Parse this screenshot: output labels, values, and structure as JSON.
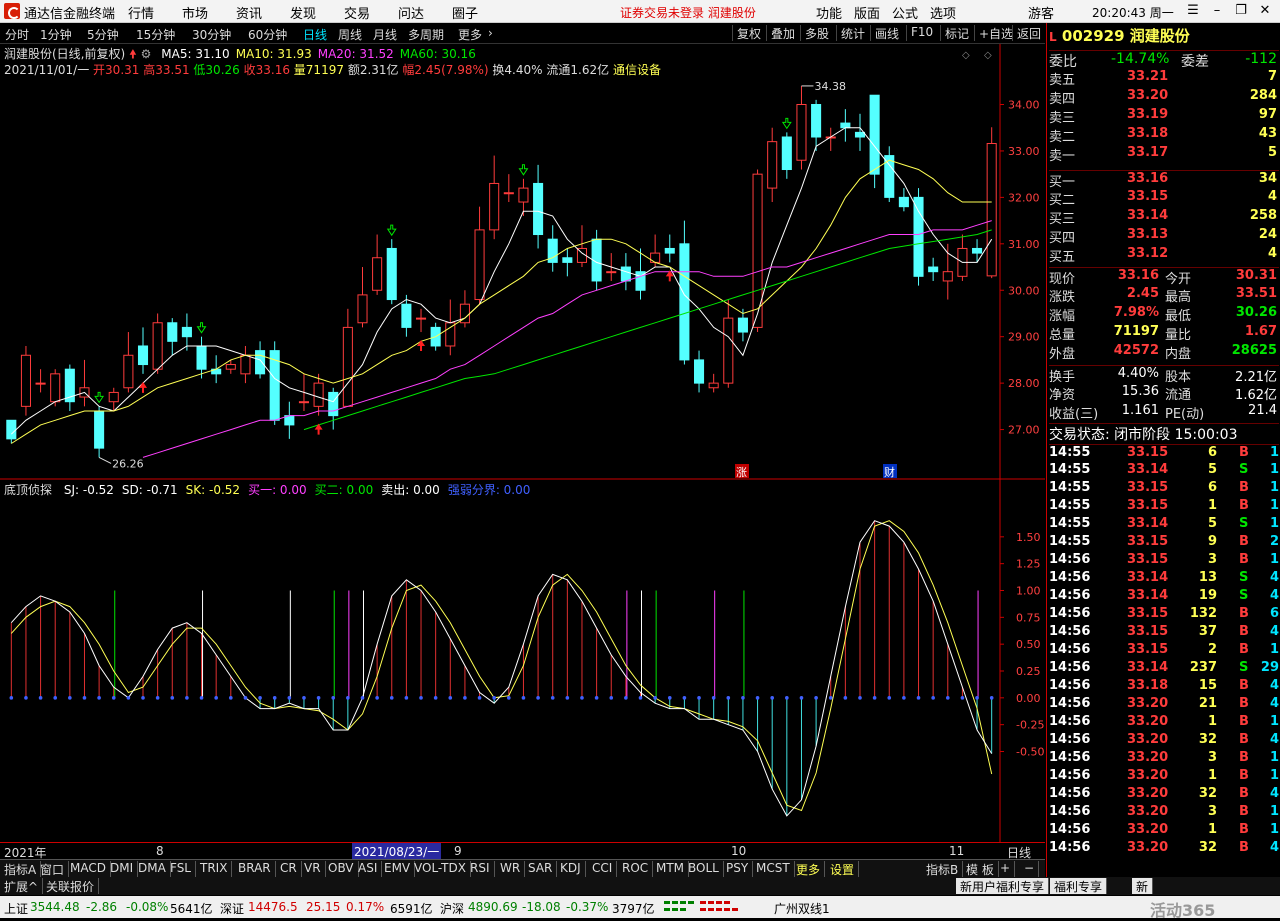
{
  "title_bar": {
    "app_name": "通达信金融终端",
    "menus": [
      "行情",
      "市场",
      "资讯",
      "发现",
      "交易",
      "问达",
      "圈子"
    ],
    "warning": "证券交易未登录  润建股份",
    "right_menus": [
      "功能",
      "版面",
      "公式",
      "选项"
    ],
    "guest": "游客",
    "clock": "20:20:43 周一"
  },
  "period_bar": {
    "items": [
      "分时",
      "1分钟",
      "5分钟",
      "15分钟",
      "30分钟",
      "60分钟",
      "日线",
      "周线",
      "月线",
      "多周期",
      "更多"
    ],
    "active": "日线",
    "tools": [
      "复权",
      "叠加",
      "多股",
      "统计",
      "画线",
      "F10",
      "标记",
      "+自选",
      "返回"
    ]
  },
  "main_chart": {
    "title": "润建股份(日线,前复权)",
    "ma_labels": [
      {
        "text": "MA5: 31.10",
        "color": "#ffffff"
      },
      {
        "text": "MA10: 31.93",
        "color": "#ffff54"
      },
      {
        "text": "MA20: 31.52",
        "color": "#ff40ff"
      },
      {
        "text": "MA60: 30.16",
        "color": "#00e600"
      }
    ],
    "info": {
      "date": "2021/11/01/一",
      "open": "开30.31",
      "high": "高33.51",
      "low": "低30.26",
      "close": "收33.16",
      "volume": "量71197",
      "amount": "额2.31亿",
      "change": "幅2.45(7.98%)",
      "turnover": "换4.40%",
      "float": "流通1.62亿",
      "industry": "通信设备"
    },
    "price_axis": [
      "34.00",
      "33.00",
      "32.00",
      "31.00",
      "30.00",
      "29.00",
      "28.00",
      "27.00"
    ],
    "high_mark": "34.38",
    "low_mark": "26.26",
    "event_zhang": "涨",
    "event_cai": "财"
  },
  "indicator": {
    "name": "底顶侦探",
    "labels": [
      {
        "text": "SJ: -0.52",
        "color": "#ffffff"
      },
      {
        "text": "SD: -0.71",
        "color": "#ffffff"
      },
      {
        "text": "SK: -0.52",
        "color": "#ffff54"
      },
      {
        "text": "买一: 0.00",
        "color": "#ff40ff"
      },
      {
        "text": "买二: 0.00",
        "color": "#00e600"
      },
      {
        "text": "卖出: 0.00",
        "color": "#ffffff"
      },
      {
        "text": "强弱分界: 0.00",
        "color": "#4060ff"
      }
    ],
    "axis": [
      "1.50",
      "1.25",
      "1.00",
      "0.75",
      "0.50",
      "0.25",
      "0.00",
      "-0.25",
      "-0.50"
    ]
  },
  "time_axis": {
    "labels": [
      "2021年",
      "8",
      "9",
      "10",
      "11"
    ],
    "cursor_date": "2021/08/23/一",
    "mode": "日线"
  },
  "quote_panel": {
    "code": "002929",
    "name": "润建股份",
    "weibi_label": "委比",
    "weibi": "-14.74%",
    "weicha_label": "委差",
    "weicha": "-112",
    "asks": [
      {
        "label": "卖五",
        "price": "33.21",
        "vol": "7"
      },
      {
        "label": "卖四",
        "price": "33.20",
        "vol": "284"
      },
      {
        "label": "卖三",
        "price": "33.19",
        "vol": "97"
      },
      {
        "label": "卖二",
        "price": "33.18",
        "vol": "43"
      },
      {
        "label": "卖一",
        "price": "33.17",
        "vol": "5"
      }
    ],
    "bids": [
      {
        "label": "买一",
        "price": "33.16",
        "vol": "34"
      },
      {
        "label": "买二",
        "price": "33.15",
        "vol": "4"
      },
      {
        "label": "买三",
        "price": "33.14",
        "vol": "258"
      },
      {
        "label": "买四",
        "price": "33.13",
        "vol": "24"
      },
      {
        "label": "买五",
        "price": "33.12",
        "vol": "4"
      }
    ],
    "stats": [
      {
        "l1": "现价",
        "v1": "33.16",
        "c1": "red",
        "l2": "今开",
        "v2": "30.31",
        "c2": "red"
      },
      {
        "l1": "涨跌",
        "v1": "2.45",
        "c1": "red",
        "l2": "最高",
        "v2": "33.51",
        "c2": "red"
      },
      {
        "l1": "涨幅",
        "v1": "7.98%",
        "c1": "red",
        "l2": "最低",
        "v2": "30.26",
        "c2": "green"
      },
      {
        "l1": "总量",
        "v1": "71197",
        "c1": "yellow",
        "l2": "量比",
        "v2": "1.67",
        "c2": "red"
      },
      {
        "l1": "外盘",
        "v1": "42572",
        "c1": "red",
        "l2": "内盘",
        "v2": "28625",
        "c2": "green"
      }
    ],
    "stats2": [
      {
        "l1": "换手",
        "v1": "4.40%",
        "l2": "股本",
        "v2": "2.21亿"
      },
      {
        "l1": "净资",
        "v1": "15.36",
        "l2": "流通",
        "v2": "1.62亿"
      },
      {
        "l1": "收益(三)",
        "v1": "1.161",
        "l2": "PE(动)",
        "v2": "21.4"
      }
    ],
    "trade_status": "交易状态: 闭市阶段 15:00:03",
    "ticks": [
      {
        "t": "14:55",
        "p": "33.15",
        "v": "6",
        "d": "B",
        "n": "1"
      },
      {
        "t": "14:55",
        "p": "33.14",
        "v": "5",
        "d": "S",
        "n": "1"
      },
      {
        "t": "14:55",
        "p": "33.15",
        "v": "6",
        "d": "B",
        "n": "1"
      },
      {
        "t": "14:55",
        "p": "33.15",
        "v": "1",
        "d": "B",
        "n": "1"
      },
      {
        "t": "14:55",
        "p": "33.14",
        "v": "5",
        "d": "S",
        "n": "1"
      },
      {
        "t": "14:55",
        "p": "33.15",
        "v": "9",
        "d": "B",
        "n": "2"
      },
      {
        "t": "14:56",
        "p": "33.15",
        "v": "3",
        "d": "B",
        "n": "1"
      },
      {
        "t": "14:56",
        "p": "33.14",
        "v": "13",
        "d": "S",
        "n": "4"
      },
      {
        "t": "14:56",
        "p": "33.14",
        "v": "19",
        "d": "S",
        "n": "4"
      },
      {
        "t": "14:56",
        "p": "33.15",
        "v": "132",
        "d": "B",
        "n": "6"
      },
      {
        "t": "14:56",
        "p": "33.15",
        "v": "37",
        "d": "B",
        "n": "4"
      },
      {
        "t": "14:56",
        "p": "33.15",
        "v": "2",
        "d": "B",
        "n": "1"
      },
      {
        "t": "14:56",
        "p": "33.14",
        "v": "237",
        "d": "S",
        "n": "29"
      },
      {
        "t": "14:56",
        "p": "33.18",
        "v": "15",
        "d": "B",
        "n": "4"
      },
      {
        "t": "14:56",
        "p": "33.20",
        "v": "21",
        "d": "B",
        "n": "4"
      },
      {
        "t": "14:56",
        "p": "33.20",
        "v": "1",
        "d": "B",
        "n": "1"
      },
      {
        "t": "14:56",
        "p": "33.20",
        "v": "32",
        "d": "B",
        "n": "4"
      },
      {
        "t": "14:56",
        "p": "33.20",
        "v": "3",
        "d": "B",
        "n": "1"
      },
      {
        "t": "14:56",
        "p": "33.20",
        "v": "1",
        "d": "B",
        "n": "1"
      },
      {
        "t": "14:56",
        "p": "33.20",
        "v": "32",
        "d": "B",
        "n": "4"
      },
      {
        "t": "14:56",
        "p": "33.20",
        "v": "3",
        "d": "B",
        "n": "1"
      },
      {
        "t": "14:56",
        "p": "33.20",
        "v": "1",
        "d": "B",
        "n": "1"
      },
      {
        "t": "14:56",
        "p": "33.20",
        "v": "32",
        "d": "B",
        "n": "4"
      }
    ]
  },
  "tabs": [
    "指标A",
    "窗口",
    "MACD",
    "DMI",
    "DMA",
    "FSL",
    "TRIX",
    "BRAR",
    "CR",
    "VR",
    "OBV",
    "ASI",
    "EMV",
    "VOL-TDX",
    "RSI",
    "WR",
    "SAR",
    "KDJ",
    "CCI",
    "ROC",
    "MTM",
    "BOLL",
    "PSY",
    "MCST",
    "更多",
    "设置"
  ],
  "tabs_right": [
    "指标B",
    "模 板",
    "+",
    "−"
  ],
  "tabs2": [
    "扩展^",
    "关联报价"
  ],
  "tabs2_right": [
    "新用户福利专享",
    "福利专享",
    "新"
  ],
  "status_bar": {
    "sh_label": "上证",
    "sh_val": "3544.48",
    "sh_chg": "-2.86",
    "sh_pct": "-0.08%",
    "sh_amt": "5641亿",
    "sz_label": "深证",
    "sz_val": "14476.5",
    "sz_chg": "25.15",
    "sz_pct": "0.17%",
    "sz_amt": "6591亿",
    "hs_label": "沪深",
    "hs_val": "4890.69",
    "hs_chg": "-18.08",
    "hs_pct": "-0.37%",
    "hs_amt": "3797亿",
    "server": "广州双线1",
    "watermark": "活动365"
  },
  "chart_data": {
    "type": "candlestick",
    "title": "润建股份(日线,前复权)",
    "y_range": [
      26.0,
      34.7
    ],
    "candles": [
      [
        27.2,
        26.8,
        27.0,
        26.7
      ],
      [
        27.5,
        28.6,
        28.8,
        27.3
      ],
      [
        28.0,
        28.0,
        28.3,
        27.8
      ],
      [
        27.6,
        28.2,
        28.3,
        27.5
      ],
      [
        28.3,
        27.6,
        28.4,
        27.4
      ],
      [
        27.7,
        27.9,
        28.5,
        27.5
      ],
      [
        27.4,
        26.6,
        27.5,
        26.4
      ],
      [
        27.6,
        27.8,
        27.9,
        27.4
      ],
      [
        27.9,
        28.6,
        29.1,
        27.8
      ],
      [
        28.8,
        28.4,
        29.2,
        28.2
      ],
      [
        28.3,
        29.3,
        29.5,
        28.2
      ],
      [
        29.3,
        28.9,
        29.4,
        28.6
      ],
      [
        29.2,
        29.0,
        29.5,
        28.7
      ],
      [
        28.8,
        28.3,
        29.0,
        28.1
      ],
      [
        28.3,
        28.2,
        28.6,
        28.0
      ],
      [
        28.3,
        28.4,
        28.5,
        28.2
      ],
      [
        28.2,
        28.6,
        28.8,
        28.0
      ],
      [
        28.7,
        28.2,
        28.9,
        28.1
      ],
      [
        28.7,
        27.2,
        28.9,
        27.1
      ],
      [
        27.3,
        27.1,
        27.6,
        26.8
      ],
      [
        27.6,
        27.6,
        28.2,
        27.4
      ],
      [
        27.5,
        28.0,
        28.2,
        27.3
      ],
      [
        27.8,
        27.3,
        27.9,
        27.0
      ],
      [
        27.5,
        29.2,
        29.6,
        27.5
      ],
      [
        29.3,
        29.9,
        30.5,
        29.2
      ],
      [
        30.0,
        30.7,
        31.2,
        29.9
      ],
      [
        30.9,
        29.8,
        31.1,
        29.7
      ],
      [
        29.7,
        29.2,
        29.9,
        29.0
      ],
      [
        29.4,
        29.4,
        29.6,
        29.1
      ],
      [
        29.2,
        28.8,
        29.3,
        28.7
      ],
      [
        28.8,
        29.3,
        29.8,
        28.6
      ],
      [
        29.3,
        29.7,
        30.0,
        29.2
      ],
      [
        29.8,
        31.3,
        31.8,
        29.7
      ],
      [
        31.3,
        32.3,
        32.9,
        31.1
      ],
      [
        32.1,
        32.1,
        32.5,
        31.9
      ],
      [
        31.9,
        32.2,
        32.4,
        31.6
      ],
      [
        32.3,
        31.2,
        32.7,
        30.9
      ],
      [
        31.1,
        30.6,
        31.4,
        30.4
      ],
      [
        30.7,
        30.6,
        30.9,
        30.3
      ],
      [
        30.6,
        30.9,
        31.4,
        30.5
      ],
      [
        31.1,
        30.2,
        31.3,
        30.0
      ],
      [
        30.4,
        30.4,
        30.8,
        30.2
      ],
      [
        30.5,
        30.2,
        30.8,
        30.0
      ],
      [
        30.4,
        30.0,
        30.9,
        29.8
      ],
      [
        30.6,
        30.8,
        31.2,
        30.5
      ],
      [
        30.9,
        30.8,
        31.2,
        30.6
      ],
      [
        31.0,
        28.5,
        31.5,
        28.4
      ],
      [
        28.5,
        28.0,
        28.7,
        27.8
      ],
      [
        27.9,
        28.0,
        28.2,
        27.8
      ],
      [
        28.0,
        29.4,
        29.8,
        27.9
      ],
      [
        29.4,
        29.1,
        29.6,
        28.9
      ],
      [
        29.2,
        32.5,
        32.6,
        29.1
      ],
      [
        32.2,
        33.2,
        33.5,
        31.9
      ],
      [
        33.3,
        32.6,
        33.4,
        32.4
      ],
      [
        32.8,
        34.0,
        34.4,
        32.6
      ],
      [
        34.0,
        33.3,
        34.1,
        33.0
      ],
      [
        33.3,
        33.3,
        33.5,
        33.0
      ],
      [
        33.6,
        33.5,
        33.9,
        33.2
      ],
      [
        33.4,
        33.3,
        33.8,
        33.0
      ],
      [
        34.2,
        32.5,
        34.2,
        32.2
      ],
      [
        32.9,
        32.0,
        33.1,
        31.9
      ],
      [
        32.0,
        31.8,
        32.2,
        31.7
      ],
      [
        32.0,
        30.3,
        32.2,
        30.1
      ],
      [
        30.5,
        30.4,
        30.7,
        30.2
      ],
      [
        30.2,
        30.4,
        31.0,
        29.8
      ],
      [
        30.3,
        30.9,
        31.2,
        30.2
      ],
      [
        30.9,
        30.8,
        31.1,
        30.6
      ],
      [
        30.31,
        33.16,
        33.51,
        30.26
      ]
    ],
    "ma5": [
      26.9,
      27.2,
      27.4,
      27.6,
      27.7,
      27.8,
      27.5,
      27.4,
      27.7,
      28.0,
      28.3,
      28.6,
      28.8,
      28.8,
      28.8,
      28.7,
      28.6,
      28.5,
      28.1,
      27.9,
      27.8,
      27.7,
      27.6,
      28.0,
      28.4,
      29.1,
      29.6,
      29.8,
      29.7,
      29.4,
      29.3,
      29.4,
      29.7,
      30.4,
      31.0,
      31.7,
      31.7,
      31.6,
      31.1,
      30.8,
      30.6,
      30.5,
      30.4,
      30.3,
      30.5,
      30.5,
      29.9,
      29.6,
      29.2,
      29.0,
      28.6,
      29.5,
      30.6,
      31.4,
      32.2,
      33.1,
      33.3,
      33.5,
      33.5,
      33.1,
      32.7,
      32.3,
      31.7,
      31.2,
      30.8,
      30.6,
      30.6,
      31.1
    ],
    "ma10": [
      26.7,
      26.9,
      27.1,
      27.2,
      27.3,
      27.4,
      27.4,
      27.4,
      27.5,
      27.7,
      27.9,
      28.0,
      28.1,
      28.2,
      28.3,
      28.5,
      28.6,
      28.6,
      28.5,
      28.4,
      28.2,
      28.1,
      28.0,
      28.1,
      28.2,
      28.4,
      28.6,
      28.7,
      28.9,
      29.0,
      29.2,
      29.4,
      29.7,
      29.9,
      30.1,
      30.3,
      30.6,
      30.7,
      30.9,
      31.0,
      31.1,
      31.1,
      31.0,
      30.8,
      30.6,
      30.5,
      30.3,
      30.1,
      29.9,
      29.7,
      29.5,
      29.6,
      29.9,
      30.2,
      30.5,
      30.9,
      31.4,
      32.0,
      32.4,
      32.6,
      32.8,
      32.7,
      32.6,
      32.4,
      32.1,
      31.9,
      31.9,
      31.9
    ],
    "ma20": [
      null,
      null,
      null,
      null,
      null,
      null,
      null,
      null,
      null,
      26.4,
      26.5,
      26.6,
      26.7,
      26.8,
      26.9,
      27.0,
      27.1,
      27.2,
      27.2,
      27.3,
      27.3,
      27.4,
      27.4,
      27.5,
      27.6,
      27.7,
      27.8,
      27.9,
      28.0,
      28.1,
      28.3,
      28.4,
      28.6,
      28.8,
      29.0,
      29.2,
      29.4,
      29.5,
      29.7,
      29.9,
      30.0,
      30.1,
      30.2,
      30.3,
      30.4,
      30.4,
      30.4,
      30.4,
      30.3,
      30.3,
      30.3,
      30.4,
      30.5,
      30.5,
      30.6,
      30.7,
      30.8,
      30.9,
      31.0,
      31.1,
      31.2,
      31.2,
      31.2,
      31.3,
      31.3,
      31.3,
      31.4,
      31.5
    ],
    "ma60": [
      null,
      null,
      null,
      null,
      null,
      null,
      null,
      null,
      null,
      null,
      null,
      null,
      null,
      null,
      null,
      null,
      null,
      null,
      null,
      null,
      27.0,
      27.1,
      27.2,
      27.3,
      27.4,
      27.5,
      27.6,
      27.7,
      27.8,
      27.9,
      28.0,
      28.1,
      28.15,
      28.2,
      28.3,
      28.4,
      28.5,
      28.6,
      28.7,
      28.8,
      28.9,
      29.0,
      29.1,
      29.2,
      29.3,
      29.4,
      29.5,
      29.6,
      29.7,
      29.8,
      29.9,
      30.0,
      30.1,
      30.2,
      30.3,
      30.4,
      30.5,
      30.6,
      30.7,
      30.8,
      30.9,
      30.95,
      31.0,
      31.05,
      31.1,
      31.15,
      31.2,
      31.3
    ],
    "sj": [
      0.7,
      0.85,
      0.95,
      0.9,
      0.8,
      0.6,
      0.3,
      0.1,
      0.0,
      0.2,
      0.45,
      0.65,
      0.7,
      0.6,
      0.4,
      0.2,
      0.0,
      -0.1,
      -0.1,
      -0.05,
      -0.1,
      -0.1,
      -0.3,
      -0.3,
      0.0,
      0.5,
      0.95,
      1.1,
      1.0,
      0.8,
      0.55,
      0.3,
      0.05,
      -0.05,
      0.1,
      0.5,
      0.95,
      1.15,
      1.1,
      0.9,
      0.65,
      0.4,
      0.2,
      0.05,
      -0.05,
      -0.1,
      -0.1,
      -0.2,
      -0.2,
      -0.25,
      -0.3,
      -0.5,
      -0.85,
      -1.1,
      -0.95,
      -0.45,
      0.2,
      0.85,
      1.45,
      1.65,
      1.6,
      1.45,
      1.2,
      0.9,
      0.5,
      0.1,
      -0.3,
      -0.52
    ],
    "sd": [
      0.6,
      0.75,
      0.85,
      0.9,
      0.85,
      0.7,
      0.5,
      0.25,
      0.05,
      0.1,
      0.3,
      0.5,
      0.65,
      0.65,
      0.5,
      0.3,
      0.1,
      -0.05,
      -0.1,
      -0.08,
      -0.1,
      -0.12,
      -0.2,
      -0.3,
      -0.15,
      0.2,
      0.65,
      1.0,
      1.05,
      0.9,
      0.7,
      0.45,
      0.2,
      0.0,
      0.02,
      0.3,
      0.75,
      1.05,
      1.15,
      1.0,
      0.8,
      0.55,
      0.3,
      0.12,
      0.0,
      -0.08,
      -0.1,
      -0.15,
      -0.2,
      -0.22,
      -0.27,
      -0.4,
      -0.7,
      -1.0,
      -1.05,
      -0.7,
      -0.1,
      0.55,
      1.2,
      1.6,
      1.65,
      1.55,
      1.35,
      1.05,
      0.7,
      0.3,
      -0.1,
      -0.71
    ]
  }
}
